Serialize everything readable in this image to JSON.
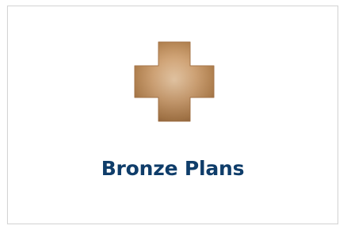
{
  "card": {
    "label": "Bronze Plans",
    "icon": "medical-cross-icon",
    "colors": {
      "label": "#0f3d6a",
      "icon_light": "#e8c7a4",
      "icon_mid": "#c99a6c",
      "icon_dark": "#8f6540",
      "border": "#d4d4d4",
      "background": "#ffffff"
    }
  }
}
